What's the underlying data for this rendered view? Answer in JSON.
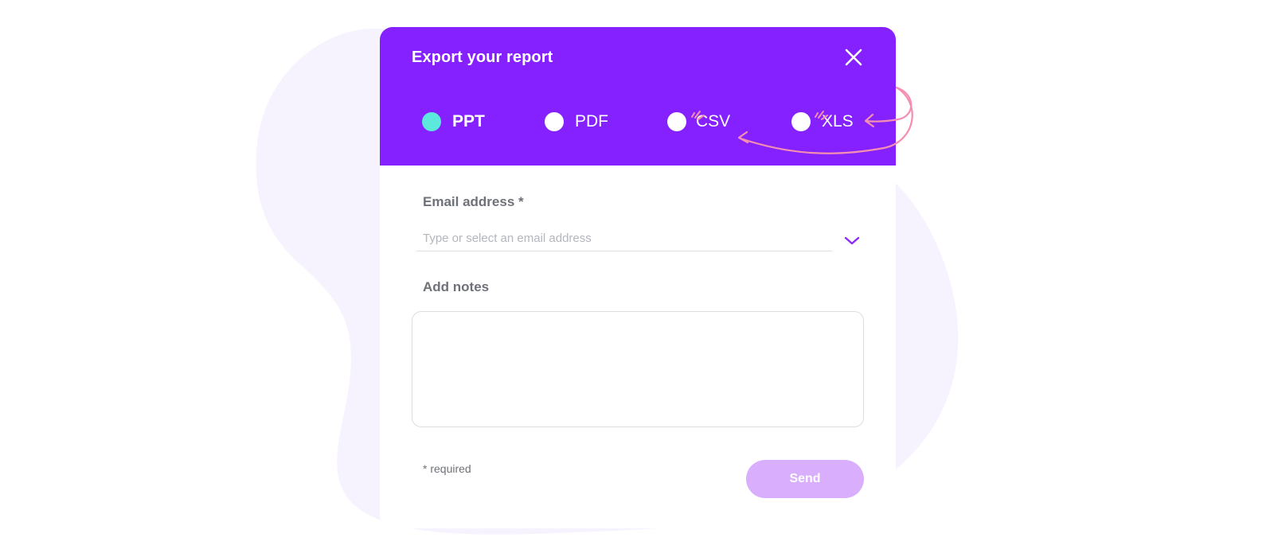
{
  "dialog": {
    "title": "Export your report",
    "close_icon": "close-icon"
  },
  "formats": {
    "selected": "PPT",
    "options": [
      {
        "label": "PPT",
        "selected": true
      },
      {
        "label": "PDF",
        "selected": false
      },
      {
        "label": "CSV",
        "selected": false
      },
      {
        "label": "XLS",
        "selected": false
      }
    ]
  },
  "email": {
    "label": "Email address *",
    "placeholder": "Type or select an email address",
    "value": "",
    "dropdown_icon": "chevron-down-icon"
  },
  "notes": {
    "label": "Add notes",
    "value": ""
  },
  "footer": {
    "required_note": "* required",
    "send_label": "Send"
  },
  "colors": {
    "header": "#8520fe",
    "radio_selected": "#5ce8dc",
    "send_button": "#d9aefd",
    "backdrop_blob": "#f6f3ff",
    "annotation": "#f48fb1"
  }
}
